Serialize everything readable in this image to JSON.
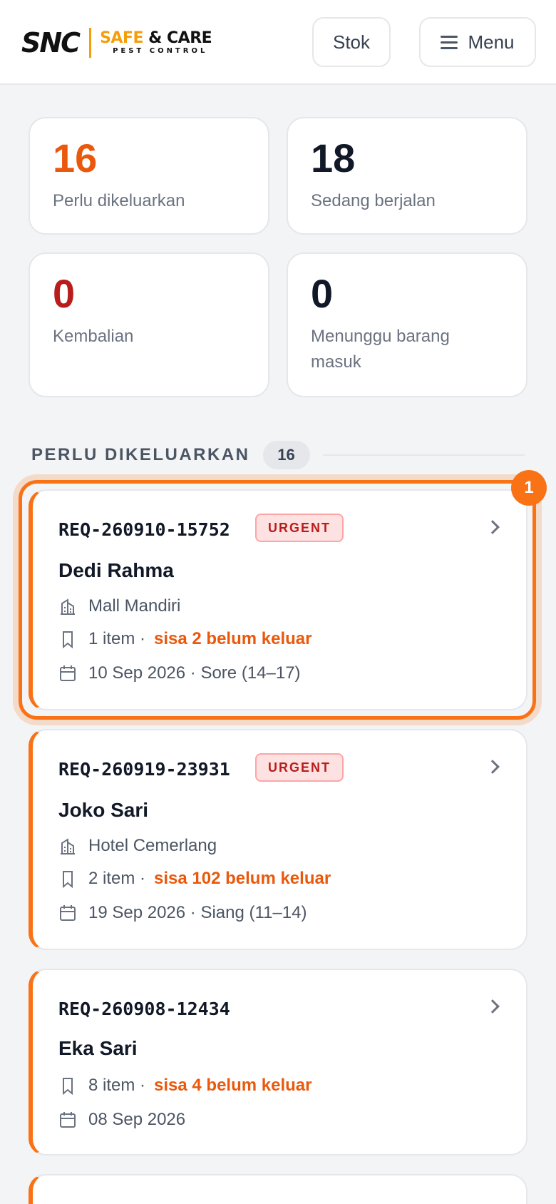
{
  "header": {
    "logo": {
      "mark": "SNC",
      "line1_a": "SAFE",
      "line1_b": "& CARE",
      "line2": "PEST CONTROL"
    },
    "stok_label": "Stok",
    "menu_label": "Menu"
  },
  "stats": [
    {
      "value": "16",
      "label": "Perlu dikeluarkan",
      "color": "#ea580c"
    },
    {
      "value": "18",
      "label": "Sedang berjalan",
      "color": "#111827"
    },
    {
      "value": "0",
      "label": "Kembalian",
      "color": "#b91c1c"
    },
    {
      "value": "0",
      "label": "Menunggu barang masuk",
      "color": "#111827"
    }
  ],
  "section": {
    "title": "PERLU DIKELUARKAN",
    "count": "16"
  },
  "focus_badge": "1",
  "requests": [
    {
      "code": "REQ-260910-15752",
      "badge": "URGENT",
      "name": "Dedi Rahma",
      "location": "Mall Mandiri",
      "items": "1 item ·",
      "remaining": "sisa 2 belum keluar",
      "schedule": "10 Sep 2026 · Sore (14–17)"
    },
    {
      "code": "REQ-260919-23931",
      "badge": "URGENT",
      "name": "Joko Sari",
      "location": "Hotel Cemerlang",
      "items": "2 item ·",
      "remaining": "sisa 102 belum keluar",
      "schedule": "19 Sep 2026 · Siang (11–14)"
    },
    {
      "code": "REQ-260908-12434",
      "name": "Eka Sari",
      "items": "8 item ·",
      "remaining": "sisa 4 belum keluar",
      "schedule": "08 Sep 2026"
    }
  ],
  "icons": {
    "location": "building-icon",
    "items": "bookmark-icon",
    "schedule": "calendar-icon",
    "open": "chevron-right-icon",
    "menu": "hamburger-icon"
  }
}
